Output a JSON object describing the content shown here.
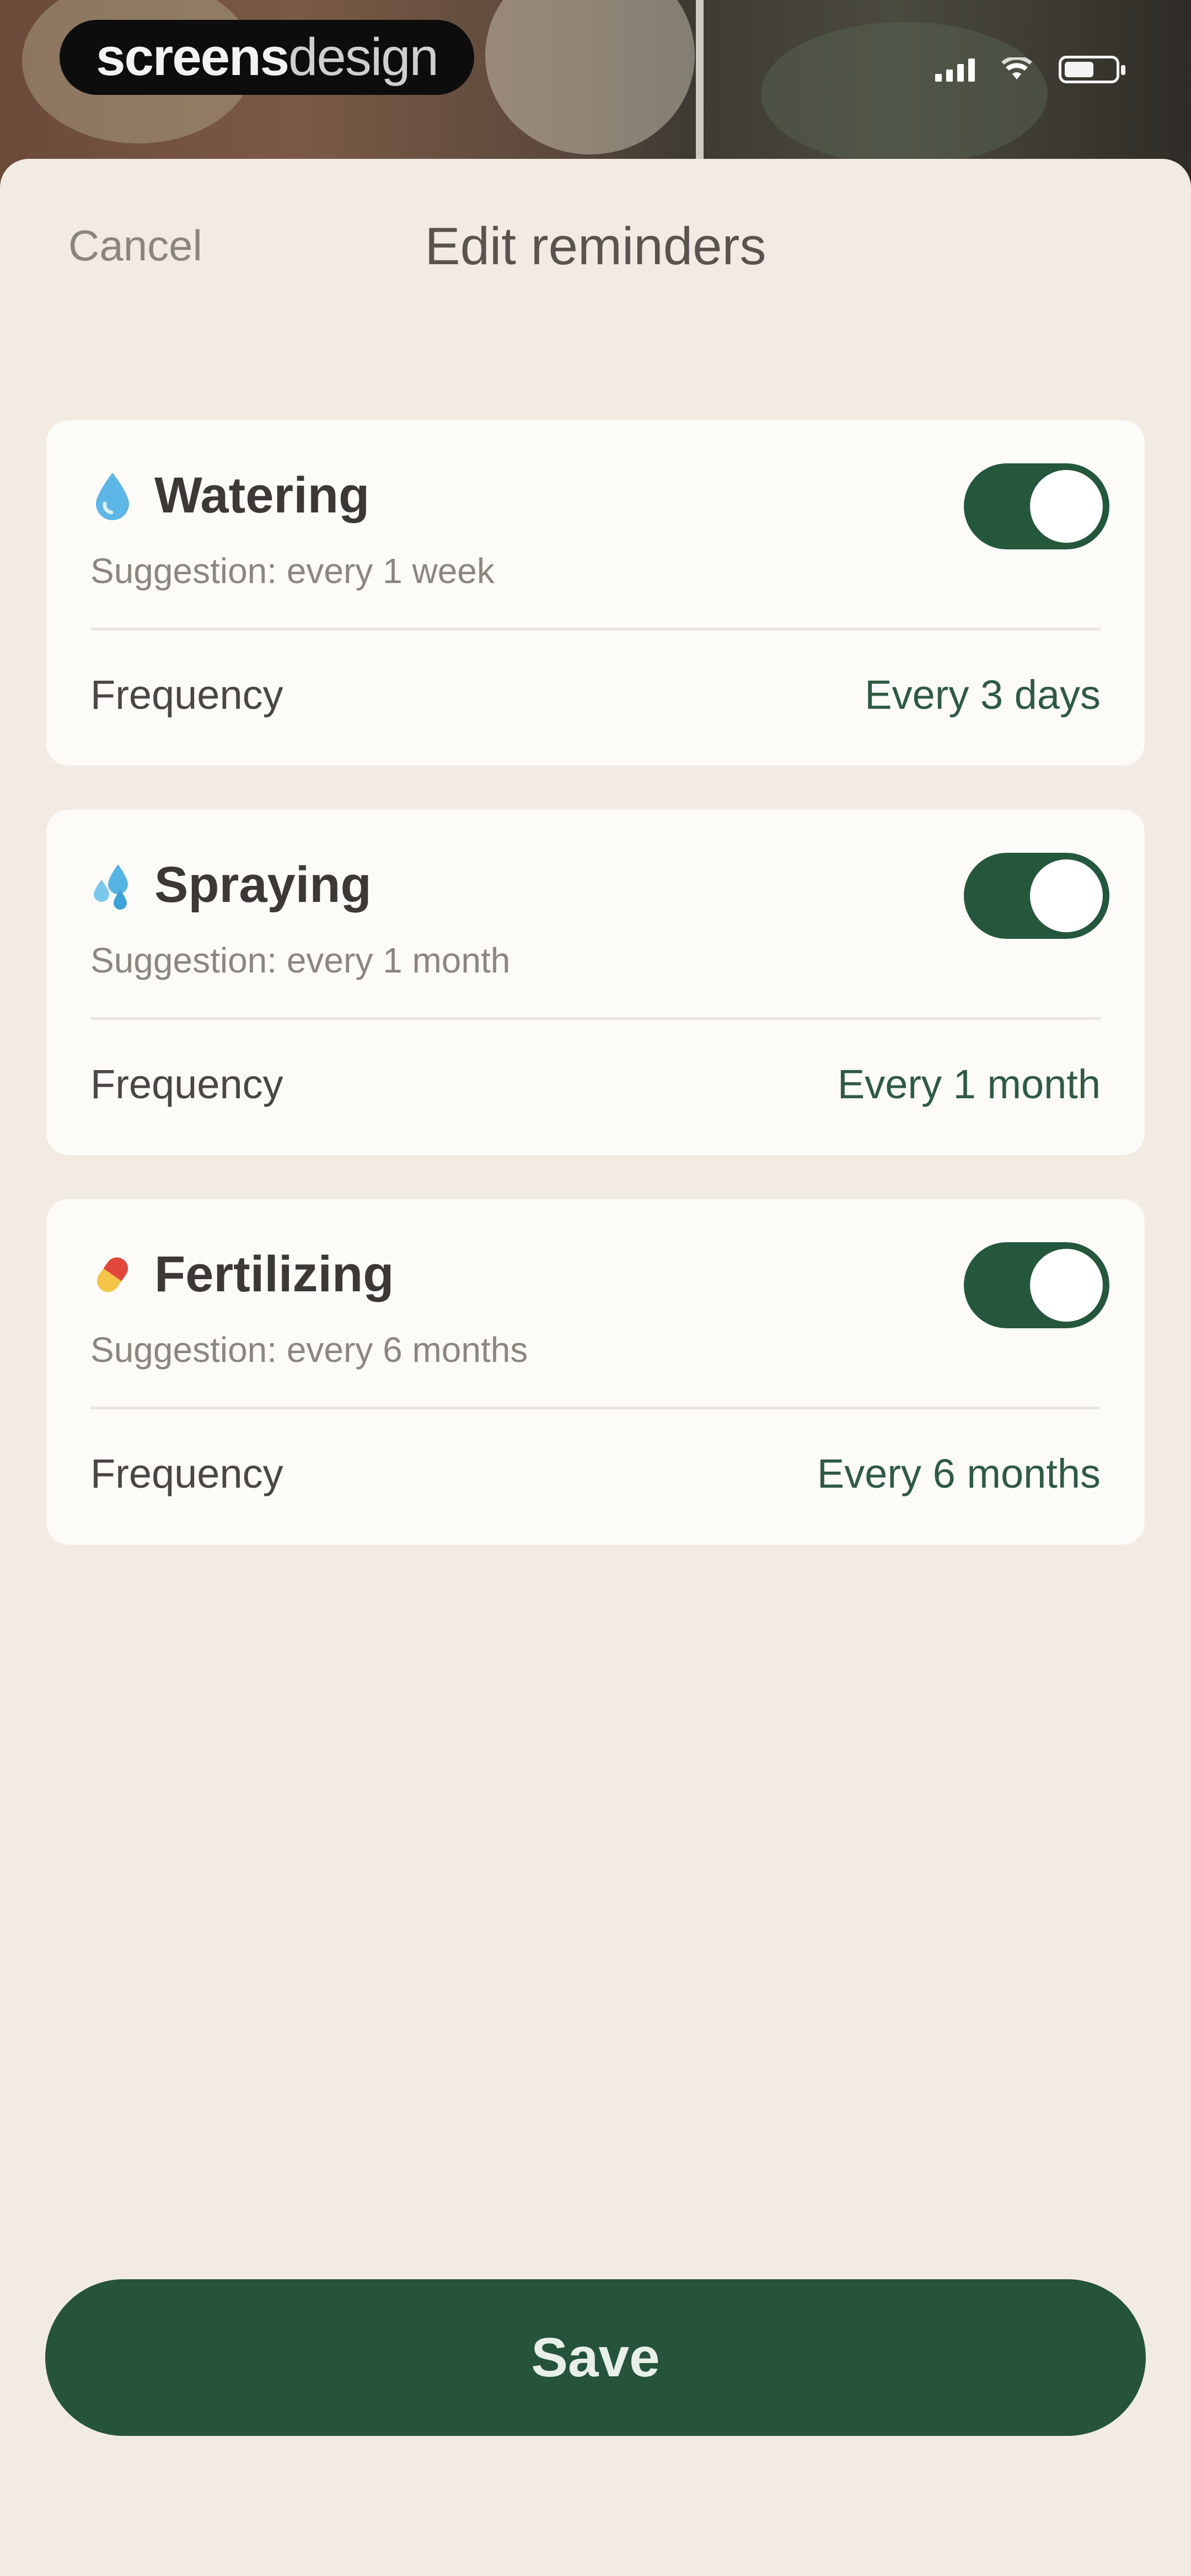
{
  "status_bar": {
    "brand_primary": "screens",
    "brand_secondary": "design",
    "icons": [
      "cellular-signal-icon",
      "wifi-icon",
      "battery-icon"
    ]
  },
  "header": {
    "cancel_label": "Cancel",
    "title": "Edit reminders"
  },
  "reminders": [
    {
      "icon": "water-drop-icon",
      "title": "Watering",
      "suggestion": "Suggestion: every 1 week",
      "frequency_label": "Frequency",
      "frequency_value": "Every 3 days",
      "enabled": true
    },
    {
      "icon": "spray-icon",
      "title": "Spraying",
      "suggestion": "Suggestion: every 1 month",
      "frequency_label": "Frequency",
      "frequency_value": "Every 1 month",
      "enabled": true
    },
    {
      "icon": "pill-icon",
      "title": "Fertilizing",
      "suggestion": "Suggestion: every 6 months",
      "frequency_label": "Frequency",
      "frequency_value": "Every 6 months",
      "enabled": true
    }
  ],
  "footer": {
    "save_label": "Save"
  },
  "colors": {
    "accent": "#25533b",
    "sheet_background": "#f2ebe4",
    "card_background": "#fcfbf8"
  }
}
